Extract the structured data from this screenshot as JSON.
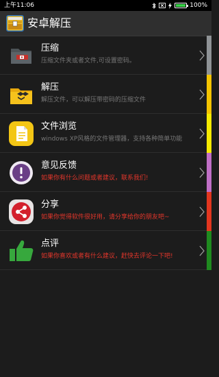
{
  "status_bar": {
    "time": "上午11:06",
    "battery_text": "100%",
    "battery_level": 1.0
  },
  "header": {
    "title": "安卓解压"
  },
  "list": {
    "items": [
      {
        "title": "压缩",
        "subtitle": "压缩文件夹或者文件,可设置密码。",
        "icon": "compress-icon",
        "strip_color": "#8f9396",
        "subtitle_color": "gray"
      },
      {
        "title": "解压",
        "subtitle": "解压文件，可以解压带密码的压缩文件",
        "icon": "extract-icon",
        "strip_color": "#f4c400",
        "subtitle_color": "gray"
      },
      {
        "title": "文件浏览",
        "subtitle": "windows XP风格的文件管理器，支持各种简单功能",
        "icon": "file-browser-icon",
        "strip_color": "#f5ea00",
        "subtitle_color": "gray"
      },
      {
        "title": "意见反馈",
        "subtitle": "如果你有什么问题或者建议，联系我们!",
        "icon": "feedback-icon",
        "strip_color": "#c06fc6",
        "subtitle_color": "red"
      },
      {
        "title": "分享",
        "subtitle": "如果你觉得软件很好用，请分享给你的朋友吧~",
        "icon": "share-icon",
        "strip_color": "#e3361f",
        "subtitle_color": "red"
      },
      {
        "title": "点评",
        "subtitle": "如果你喜欢或者有什么建议，赶快去评论一下吧!",
        "icon": "thumbs-up-icon",
        "strip_color": "#1f8a1f",
        "subtitle_color": "red"
      }
    ]
  }
}
